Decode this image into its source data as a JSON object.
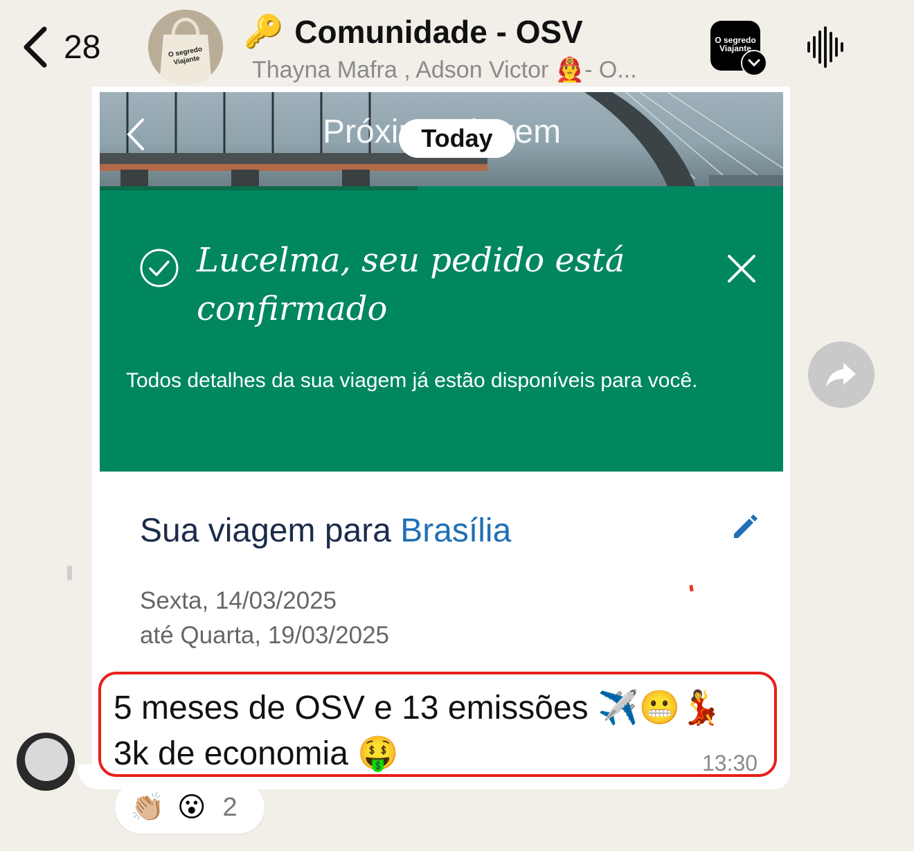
{
  "header": {
    "back_count": "28",
    "title_emoji": "🔑",
    "title": "Comunidade - OSV",
    "subtitle": "Thayna Mafra , Adson Victor 👨‍🚒- O...",
    "avatar_text": "O segredo Viajante",
    "community_icon_text": "O segredo Viajante"
  },
  "date_separator": "Today",
  "message": {
    "image": {
      "header_title": "Próxima viagem",
      "confirm_title": "Lucelma, seu pedido está confirmado",
      "banner_text": "Todos detalhes da sua viagem já estão disponíveis para você.",
      "trip_prefix": "Sua viagem para ",
      "trip_city": "Brasília",
      "date_from": "Sexta, 14/03/2025",
      "date_to": "até Quarta, 19/03/2025"
    },
    "caption_line1": "5 meses de OSV e  13 emissões ✈️😬💃",
    "caption_line2": "3k de economia 🤑",
    "time": "13:30"
  },
  "reactions": {
    "emoji1": "👏🏼",
    "emoji2": "😮",
    "count": "2"
  },
  "colors": {
    "background": "#f2efe8",
    "banner_green": "#00875f",
    "highlight_red": "#e8201a",
    "city_blue": "#1f6fb5"
  },
  "icons": [
    "chevron-left-icon",
    "community-logo-icon",
    "audio-waveform-icon",
    "check-circle-icon",
    "close-icon",
    "edit-pencil-icon",
    "forward-arrow-icon"
  ]
}
